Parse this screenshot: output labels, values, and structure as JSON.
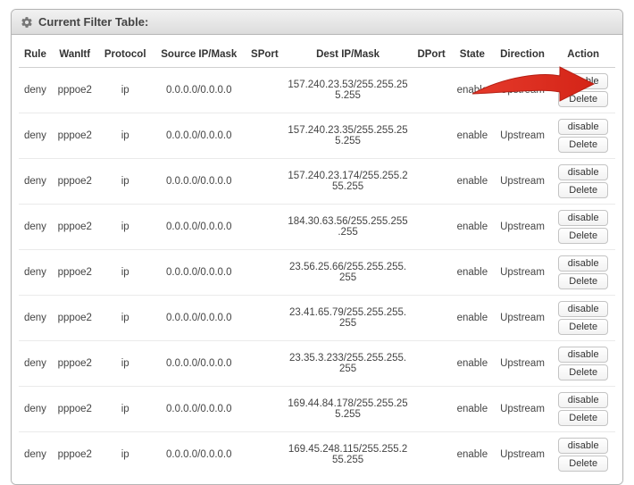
{
  "panel": {
    "title": "Current Filter Table:"
  },
  "columns": {
    "rule": "Rule",
    "wanitf": "WanItf",
    "protocol": "Protocol",
    "source": "Source IP/Mask",
    "sport": "SPort",
    "dest": "Dest IP/Mask",
    "dport": "DPort",
    "state": "State",
    "direction": "Direction",
    "action": "Action"
  },
  "buttons": {
    "disable": "disable",
    "delete": "Delete"
  },
  "rows": [
    {
      "rule": "deny",
      "wanitf": "pppoe2",
      "protocol": "ip",
      "source": "0.0.0.0/0.0.0.0",
      "sport": "",
      "dest": "157.240.23.53/255.255.255.255",
      "dport": "",
      "state": "enable",
      "direction": "Upstream"
    },
    {
      "rule": "deny",
      "wanitf": "pppoe2",
      "protocol": "ip",
      "source": "0.0.0.0/0.0.0.0",
      "sport": "",
      "dest": "157.240.23.35/255.255.255.255",
      "dport": "",
      "state": "enable",
      "direction": "Upstream"
    },
    {
      "rule": "deny",
      "wanitf": "pppoe2",
      "protocol": "ip",
      "source": "0.0.0.0/0.0.0.0",
      "sport": "",
      "dest": "157.240.23.174/255.255.255.255",
      "dport": "",
      "state": "enable",
      "direction": "Upstream"
    },
    {
      "rule": "deny",
      "wanitf": "pppoe2",
      "protocol": "ip",
      "source": "0.0.0.0/0.0.0.0",
      "sport": "",
      "dest": "184.30.63.56/255.255.255.255",
      "dport": "",
      "state": "enable",
      "direction": "Upstream"
    },
    {
      "rule": "deny",
      "wanitf": "pppoe2",
      "protocol": "ip",
      "source": "0.0.0.0/0.0.0.0",
      "sport": "",
      "dest": "23.56.25.66/255.255.255.255",
      "dport": "",
      "state": "enable",
      "direction": "Upstream"
    },
    {
      "rule": "deny",
      "wanitf": "pppoe2",
      "protocol": "ip",
      "source": "0.0.0.0/0.0.0.0",
      "sport": "",
      "dest": "23.41.65.79/255.255.255.255",
      "dport": "",
      "state": "enable",
      "direction": "Upstream"
    },
    {
      "rule": "deny",
      "wanitf": "pppoe2",
      "protocol": "ip",
      "source": "0.0.0.0/0.0.0.0",
      "sport": "",
      "dest": "23.35.3.233/255.255.255.255",
      "dport": "",
      "state": "enable",
      "direction": "Upstream"
    },
    {
      "rule": "deny",
      "wanitf": "pppoe2",
      "protocol": "ip",
      "source": "0.0.0.0/0.0.0.0",
      "sport": "",
      "dest": "169.44.84.178/255.255.255.255",
      "dport": "",
      "state": "enable",
      "direction": "Upstream"
    },
    {
      "rule": "deny",
      "wanitf": "pppoe2",
      "protocol": "ip",
      "source": "0.0.0.0/0.0.0.0",
      "sport": "",
      "dest": "169.45.248.115/255.255.255.255",
      "dport": "",
      "state": "enable",
      "direction": "Upstream"
    }
  ]
}
